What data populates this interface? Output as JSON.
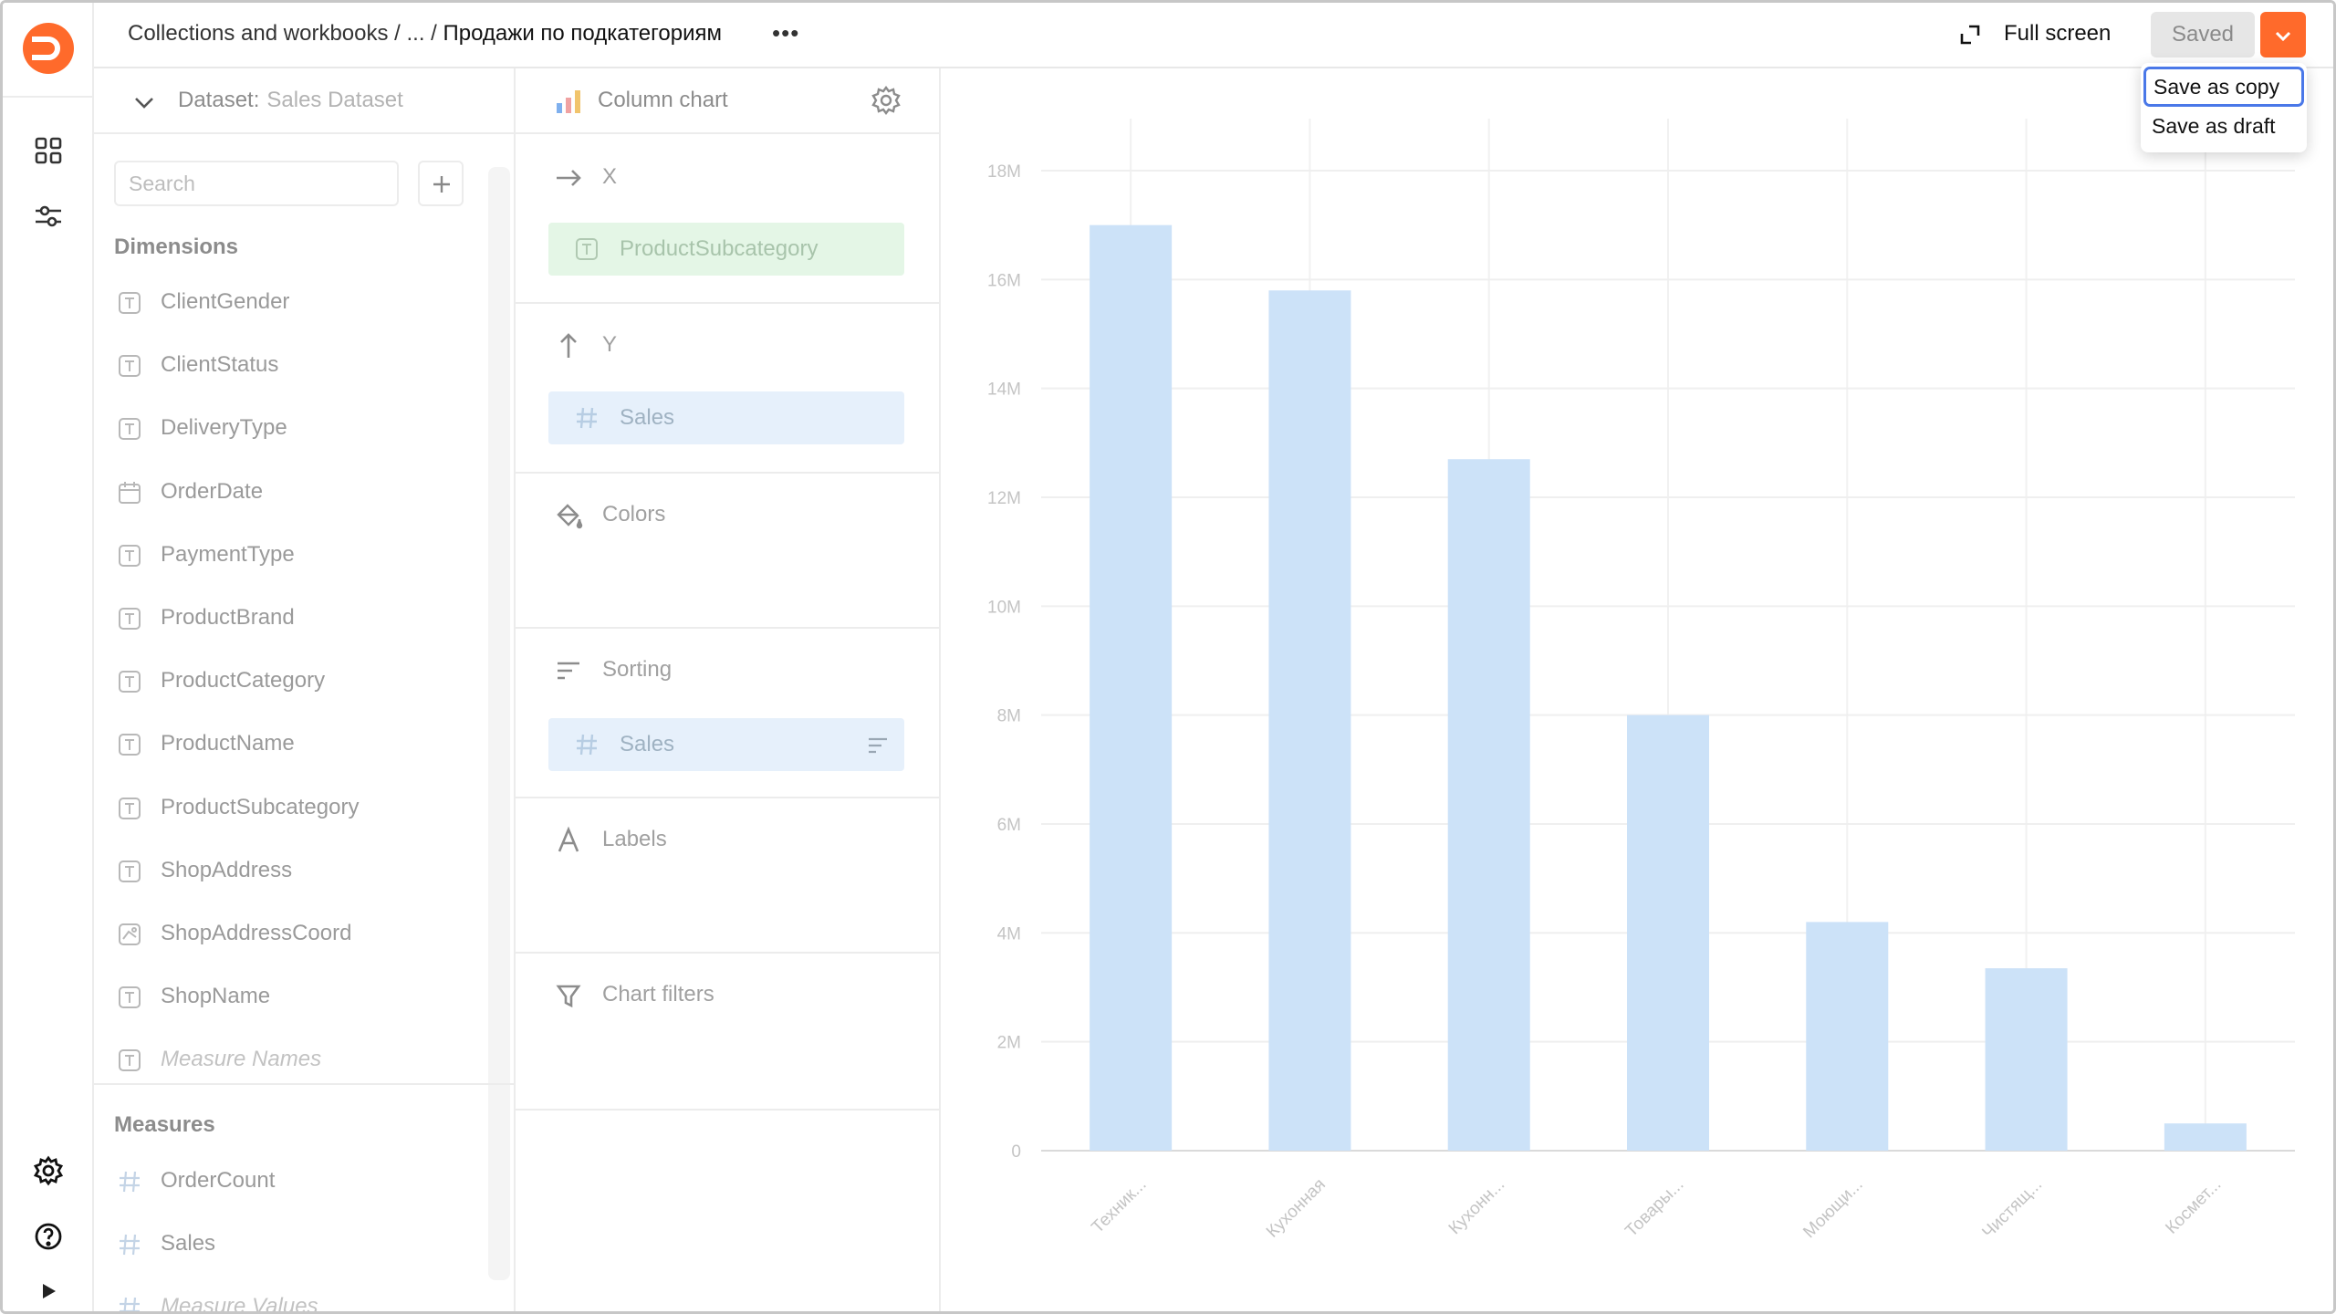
{
  "header": {
    "breadcrumb_root": "Collections and workbooks / ... / ",
    "breadcrumb_current": "Продажи по подкатегориям",
    "more_label": "•••",
    "fullscreen_label": "Full screen",
    "saved_label": "Saved",
    "accent_color": "#ff6a2b"
  },
  "save_menu": {
    "items": [
      "Save as copy",
      "Save as draft"
    ]
  },
  "dataset": {
    "prefix": "Dataset:",
    "name": "Sales Dataset",
    "search_placeholder": "Search",
    "dimensions_title": "Dimensions",
    "dimensions": [
      {
        "label": "ClientGender",
        "icon": "text-type-icon"
      },
      {
        "label": "ClientStatus",
        "icon": "text-type-icon"
      },
      {
        "label": "DeliveryType",
        "icon": "text-type-icon"
      },
      {
        "label": "OrderDate",
        "icon": "calendar-type-icon"
      },
      {
        "label": "PaymentType",
        "icon": "text-type-icon"
      },
      {
        "label": "ProductBrand",
        "icon": "text-type-icon"
      },
      {
        "label": "ProductCategory",
        "icon": "text-type-icon"
      },
      {
        "label": "ProductName",
        "icon": "text-type-icon"
      },
      {
        "label": "ProductSubcategory",
        "icon": "text-type-icon"
      },
      {
        "label": "ShopAddress",
        "icon": "text-type-icon"
      },
      {
        "label": "ShopAddressCoord",
        "icon": "geo-type-icon"
      },
      {
        "label": "ShopName",
        "icon": "text-type-icon"
      },
      {
        "label": "Measure Names",
        "icon": "text-type-icon"
      }
    ],
    "measures_title": "Measures",
    "measures": [
      {
        "label": "OrderCount",
        "icon": "number-type-icon"
      },
      {
        "label": "Sales",
        "icon": "number-type-icon"
      },
      {
        "label": "Measure Values",
        "icon": "number-type-icon"
      }
    ]
  },
  "placeholders": {
    "chart_type": "Column chart",
    "x_label": "X",
    "x_field": "ProductSubcategory",
    "y_label": "Y",
    "y_field": "Sales",
    "colors_label": "Colors",
    "sorting_label": "Sorting",
    "sorting_field": "Sales",
    "labels_label": "Labels",
    "filters_label": "Chart filters"
  },
  "chart_data": {
    "type": "bar",
    "categories": [
      "Техник...",
      "Кухонная",
      "Кухонн...",
      "Товары...",
      "Моющи...",
      "Чистящ...",
      "Космет..."
    ],
    "values": [
      17.0,
      15.8,
      12.7,
      8.0,
      4.2,
      3.35,
      0.5
    ],
    "value_unit": "M",
    "yticks": [
      "0",
      "2M",
      "4M",
      "6M",
      "8M",
      "10M",
      "12M",
      "14M",
      "16M",
      "18M"
    ],
    "ylim": [
      0,
      18
    ],
    "bar_color": "#cce2f8",
    "grid": true
  }
}
